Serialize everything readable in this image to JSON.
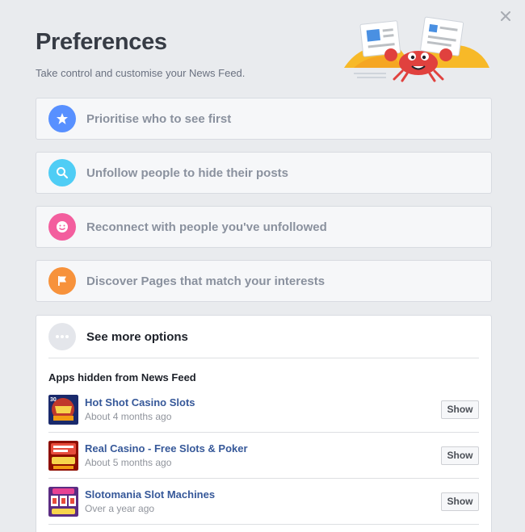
{
  "header": {
    "title": "Preferences",
    "subtitle": "Take control and customise your News Feed.",
    "close_icon": "close-icon"
  },
  "options": [
    {
      "label": "Prioritise who to see first",
      "icon": "star-icon",
      "color": "#5890ff"
    },
    {
      "label": "Unfollow people to hide their posts",
      "icon": "search-icon",
      "color": "#4fcdf5"
    },
    {
      "label": "Reconnect with people you've unfollowed",
      "icon": "smiley-icon",
      "color": "#f35e9e"
    },
    {
      "label": "Discover Pages that match your interests",
      "icon": "flag-icon",
      "color": "#f7923b"
    }
  ],
  "more": {
    "label": "See more options",
    "icon": "ellipsis-icon",
    "section_title": "Apps hidden from News Feed",
    "show_label": "Show",
    "apps": [
      {
        "name": "Hot Shot Casino Slots",
        "time": "About 4 months ago",
        "badge": "30"
      },
      {
        "name": "Real Casino - Free Slots & Poker",
        "time": "About 5 months ago"
      },
      {
        "name": "Slotomania Slot Machines",
        "time": "Over a year ago"
      }
    ]
  }
}
